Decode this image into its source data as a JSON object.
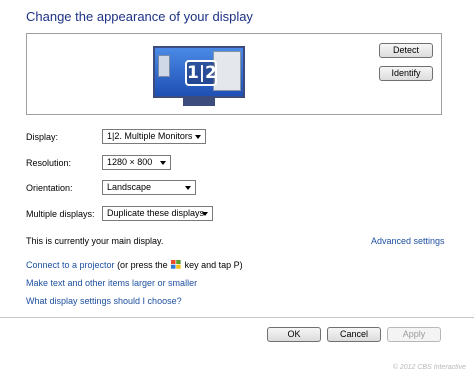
{
  "page": {
    "title": "Change the appearance of your display"
  },
  "preview": {
    "monitor_badge": "1|2",
    "detect_label": "Detect",
    "identify_label": "Identify"
  },
  "settings": {
    "display": {
      "label": "Display:",
      "value": "1|2. Multiple Monitors"
    },
    "resolution": {
      "label": "Resolution:",
      "value": "1280 × 800"
    },
    "orientation": {
      "label": "Orientation:",
      "value": "Landscape"
    },
    "multiple_displays": {
      "label": "Multiple displays:",
      "value": "Duplicate these displays"
    }
  },
  "status": {
    "main_display": "This is currently your main display.",
    "advanced_link": "Advanced settings"
  },
  "links": {
    "projector_link": "Connect to a projector",
    "projector_hint_before": " (or press the ",
    "projector_hint_after": " key and tap P)",
    "text_size": "Make text and other items larger or smaller",
    "which_settings": "What display settings should I choose?"
  },
  "footer": {
    "ok_label": "OK",
    "cancel_label": "Cancel",
    "apply_label": "Apply",
    "copyright": "© 2012 CBS Interactive"
  },
  "icons": {
    "monitor": "monitor-icon",
    "windows_key": "windows-logo-icon",
    "dropdown": "chevron-down-icon"
  }
}
